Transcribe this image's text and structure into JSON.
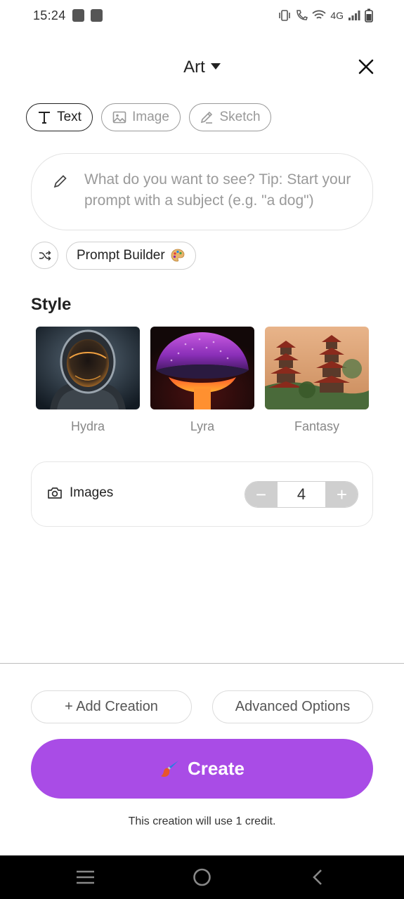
{
  "status_bar": {
    "time": "15:24",
    "network": "4G",
    "icons": [
      "notification-icon",
      "vibrate-icon",
      "wifi-calling-icon",
      "wifi-icon",
      "signal-icon",
      "battery-icon"
    ]
  },
  "header": {
    "title": "Art",
    "dropdown_icon": "caret-down-icon",
    "close_icon": "close-icon"
  },
  "mode_tabs": [
    {
      "label": "Text",
      "icon": "text-icon",
      "active": true
    },
    {
      "label": "Image",
      "icon": "image-icon",
      "active": false
    },
    {
      "label": "Sketch",
      "icon": "pencil-icon",
      "active": false
    }
  ],
  "prompt": {
    "placeholder": "What do you want to see? Tip: Start your prompt with a subject (e.g. \"a dog\")"
  },
  "prompt_tools": {
    "shuffle_icon": "shuffle-icon",
    "builder_label": "Prompt Builder",
    "builder_emoji": "palette-icon"
  },
  "style_section": {
    "title": "Style",
    "styles": [
      {
        "label": "Hydra"
      },
      {
        "label": "Lyra"
      },
      {
        "label": "Fantasy"
      }
    ]
  },
  "images_count": {
    "label": "Images",
    "icon": "camera-icon",
    "value": "4",
    "minus": "−",
    "plus": "+"
  },
  "actions": {
    "add_creation": "+ Add Creation",
    "advanced_options": "Advanced Options",
    "create": "Create",
    "create_icon": "paintbrush-icon"
  },
  "credit_note": "This creation will use 1 credit.",
  "colors": {
    "accent": "#a94ce6",
    "stepper_gray": "#cfcfcf"
  }
}
